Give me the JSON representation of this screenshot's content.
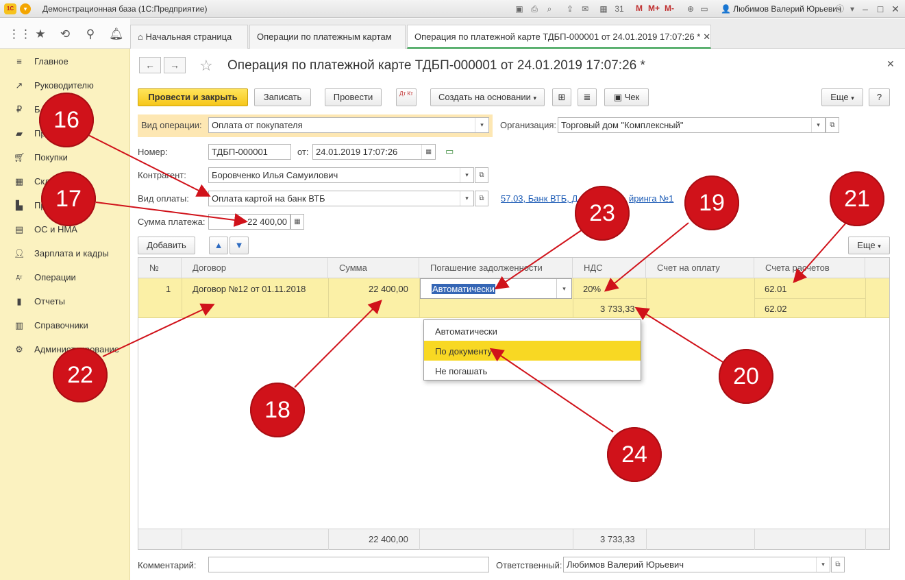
{
  "app": {
    "title": "Демонстрационная база  (1С:Предприятие)",
    "user": "Любимов Валерий Юрьевич",
    "m_labels": [
      "M",
      "M+",
      "M-"
    ]
  },
  "sidebar": {
    "items": [
      {
        "label": "Главное",
        "icon": "menu-lines-icon"
      },
      {
        "label": "Руководителю",
        "icon": "trend-icon"
      },
      {
        "label": "Б",
        "icon": "bank-coin-icon"
      },
      {
        "label": "Пр",
        "icon": "sales-bag-icon"
      },
      {
        "label": "Покупки",
        "icon": "cart-icon"
      },
      {
        "label": "Скл",
        "icon": "warehouse-icon"
      },
      {
        "label": "Пр",
        "icon": "factory-icon"
      },
      {
        "label": "ОС и НМА",
        "icon": "assets-icon"
      },
      {
        "label": "Зарплата и кадры",
        "icon": "person-icon"
      },
      {
        "label": "Операции",
        "icon": "dt-kt-icon"
      },
      {
        "label": "Отчеты",
        "icon": "bar-chart-icon"
      },
      {
        "label": "Справочники",
        "icon": "book-icon"
      },
      {
        "label": "Администрирование",
        "icon": "gear-icon"
      }
    ]
  },
  "tabs": [
    {
      "label": "Начальная страница"
    },
    {
      "label": "Операции по платежным картам"
    },
    {
      "label": "Операция по платежной карте ТДБП-000001 от 24.01.2019 17:07:26 *"
    }
  ],
  "form": {
    "title": "Операция по платежной карте ТДБП-000001 от 24.01.2019 17:07:26 *",
    "toolbar": {
      "post_close": "Провести и закрыть",
      "save": "Записать",
      "post": "Провести",
      "dtkt": "Дт Кт",
      "create_based": "Создать на основании",
      "check": "Чек",
      "more": "Еще",
      "help": "?"
    },
    "fields": {
      "op_type_label": "Вид операции:",
      "op_type_value": "Оплата от покупателя",
      "org_label": "Организация:",
      "org_value": "Торговый дом \"Комплексный\"",
      "number_label": "Номер:",
      "number_value": "ТДБП-000001",
      "from_label": "от:",
      "date_value": "24.01.2019 17:07:26",
      "counterparty_label": "Контрагент:",
      "counterparty_value": "Боровченко Илья Самуилович",
      "payment_type_label": "Вид оплаты:",
      "payment_type_value": "Оплата картой на банк ВТБ",
      "account_link": "57.03, Банк ВТБ, Д",
      "account_link_tail": "йринга №1",
      "amount_label": "Сумма платежа:",
      "amount_value": "22 400,00",
      "comment_label": "Комментарий:",
      "comment_value": "",
      "responsible_label": "Ответственный:",
      "responsible_value": "Любимов Валерий Юрьевич"
    },
    "table_toolbar": {
      "add": "Добавить",
      "more": "Еще"
    },
    "table": {
      "headers": [
        "№",
        "Договор",
        "Сумма",
        "Погашение задолженности",
        "НДС",
        "Счет на оплату",
        "Счета расчетов"
      ],
      "row": {
        "n": "1",
        "contract": "Договор №12 от 01.11.2018",
        "sum": "22 400,00",
        "repay": "Автоматически",
        "vat_rate": "20%",
        "vat_amount": "3 733,33",
        "invoice": "",
        "account1": "62.01",
        "account2": "62.02"
      },
      "totals": {
        "sum": "22 400,00",
        "vat": "3 733,33"
      }
    },
    "dropdown_options": [
      "Автоматически",
      "По документу",
      "Не погашать"
    ],
    "dropdown_selected": "По документу"
  },
  "callouts": [
    "16",
    "17",
    "18",
    "19",
    "20",
    "21",
    "22",
    "23",
    "24"
  ],
  "colors": {
    "callout": "#d0121a",
    "arrow": "#d0121a",
    "sidebar": "#fbf2c0",
    "row": "#fbf0a6",
    "primary": "#f6c61a"
  }
}
